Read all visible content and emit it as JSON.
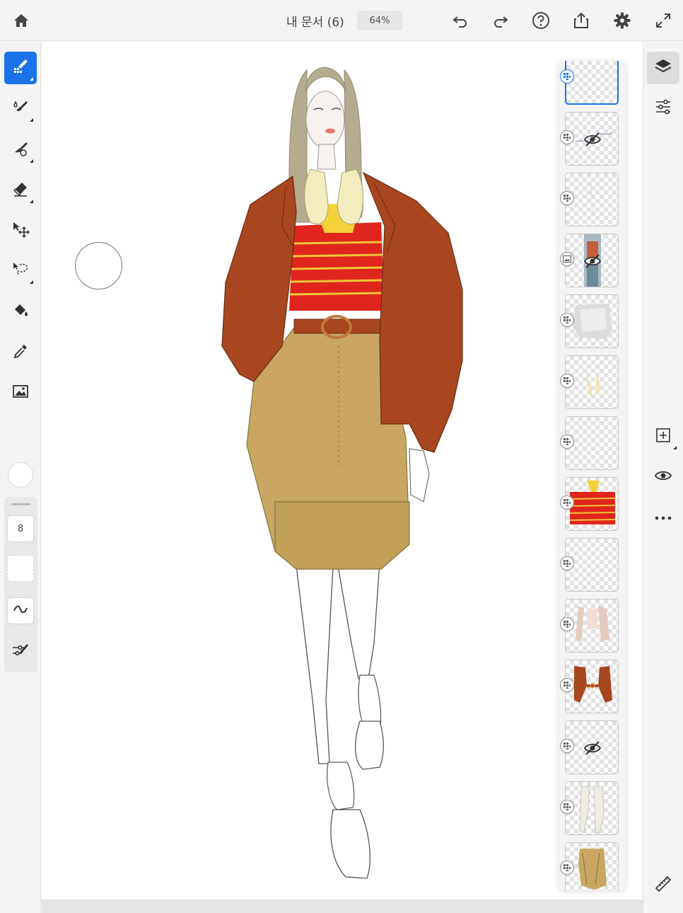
{
  "topbar": {
    "home_icon": "home-icon",
    "doc_title": "내 문서 (6)",
    "zoom": "64%",
    "undo_icon": "undo-icon",
    "redo_icon": "redo-icon",
    "help_icon": "help-icon",
    "share_icon": "share-icon",
    "settings_icon": "gear-icon",
    "fullscreen_icon": "fullscreen-icon"
  },
  "tools": [
    {
      "name": "pixel-brush",
      "icon": "pixel-brush-icon",
      "active": true
    },
    {
      "name": "live-brush",
      "icon": "live-brush-icon",
      "active": false
    },
    {
      "name": "mixer-brush",
      "icon": "mixer-brush-icon",
      "active": false
    },
    {
      "name": "eraser",
      "icon": "eraser-icon",
      "active": false
    },
    {
      "name": "move",
      "icon": "move-icon",
      "active": false
    },
    {
      "name": "lasso",
      "icon": "lasso-icon",
      "active": false
    },
    {
      "name": "fill",
      "icon": "paint-bucket-icon",
      "active": false
    },
    {
      "name": "eyedropper",
      "icon": "eyedropper-icon",
      "active": false
    },
    {
      "name": "image",
      "icon": "image-icon",
      "active": false
    }
  ],
  "brush": {
    "color": "#ffffff",
    "size": "8",
    "smoothing_icon": "tilde-icon",
    "settings_icon": "brush-settings-icon"
  },
  "layers": [
    {
      "type": "pixel",
      "selected": true,
      "hidden": false,
      "thumb": "empty"
    },
    {
      "type": "pixel",
      "selected": false,
      "hidden": true,
      "thumb": "sketch-lines"
    },
    {
      "type": "pixel",
      "selected": false,
      "hidden": false,
      "thumb": "faint"
    },
    {
      "type": "image",
      "selected": false,
      "hidden": true,
      "thumb": "photo"
    },
    {
      "type": "pixel",
      "selected": false,
      "hidden": false,
      "thumb": "grey-shading"
    },
    {
      "type": "pixel",
      "selected": false,
      "hidden": false,
      "thumb": "cream-collar"
    },
    {
      "type": "pixel",
      "selected": false,
      "hidden": false,
      "thumb": "empty"
    },
    {
      "type": "pixel",
      "selected": false,
      "hidden": false,
      "thumb": "red-stripes"
    },
    {
      "type": "pixel",
      "selected": false,
      "hidden": false,
      "thumb": "empty"
    },
    {
      "type": "pixel",
      "selected": false,
      "hidden": false,
      "thumb": "jacket-sketch"
    },
    {
      "type": "pixel",
      "selected": false,
      "hidden": false,
      "thumb": "brown-jacket"
    },
    {
      "type": "pixel",
      "selected": false,
      "hidden": true,
      "thumb": "empty"
    },
    {
      "type": "pixel",
      "selected": false,
      "hidden": false,
      "thumb": "legs-sketch"
    },
    {
      "type": "pixel",
      "selected": false,
      "hidden": false,
      "thumb": "khaki-shorts"
    }
  ],
  "rightbar": {
    "layers_icon": "layers-icon",
    "properties_icon": "sliders-icon",
    "add_layer_icon": "add-layer-icon",
    "visibility_icon": "eye-icon",
    "more_icon": "more-icon",
    "ruler_icon": "ruler-icon"
  },
  "colors": {
    "accent": "#1a73e8",
    "jacket": "#a8461f",
    "top_red": "#e0261c",
    "top_stripe": "#f2c53a",
    "shorts": "#c9a762",
    "hair": "#b5ab8e",
    "collar": "#f2ecbf"
  }
}
